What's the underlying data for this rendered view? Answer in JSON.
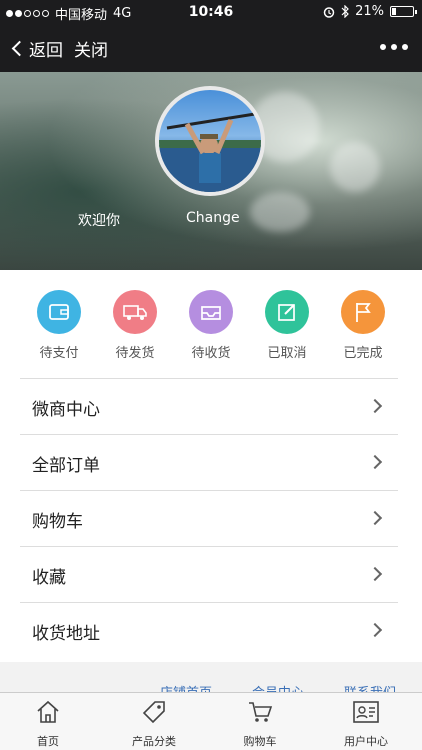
{
  "status": {
    "carrier": "中国移动",
    "network": "4G",
    "time": "10:46",
    "battery": "21%",
    "battery_level": 0.21
  },
  "nav": {
    "back_label": "返回",
    "close_label": "关闭"
  },
  "profile": {
    "welcome": "欢迎你",
    "change": "Change"
  },
  "order_status": [
    {
      "label": "待支付",
      "color": "#3fb4e3",
      "icon": "wallet-icon"
    },
    {
      "label": "待发货",
      "color": "#f07d86",
      "icon": "truck-icon"
    },
    {
      "label": "待收货",
      "color": "#b58ee0",
      "icon": "inbox-icon"
    },
    {
      "label": "已取消",
      "color": "#2fc39a",
      "icon": "edit-icon"
    },
    {
      "label": "已完成",
      "color": "#f5953b",
      "icon": "flag-icon"
    }
  ],
  "menu": [
    {
      "label": "微商中心"
    },
    {
      "label": "全部订单"
    },
    {
      "label": "购物车"
    },
    {
      "label": "收藏"
    },
    {
      "label": "收货地址"
    }
  ],
  "footer_links": [
    "店铺首页",
    "会员中心",
    "联系我们"
  ],
  "tabbar": [
    {
      "label": "首页",
      "icon": "home-icon"
    },
    {
      "label": "产品分类",
      "icon": "tag-icon"
    },
    {
      "label": "购物车",
      "icon": "cart-icon"
    },
    {
      "label": "用户中心",
      "icon": "user-card-icon"
    }
  ]
}
